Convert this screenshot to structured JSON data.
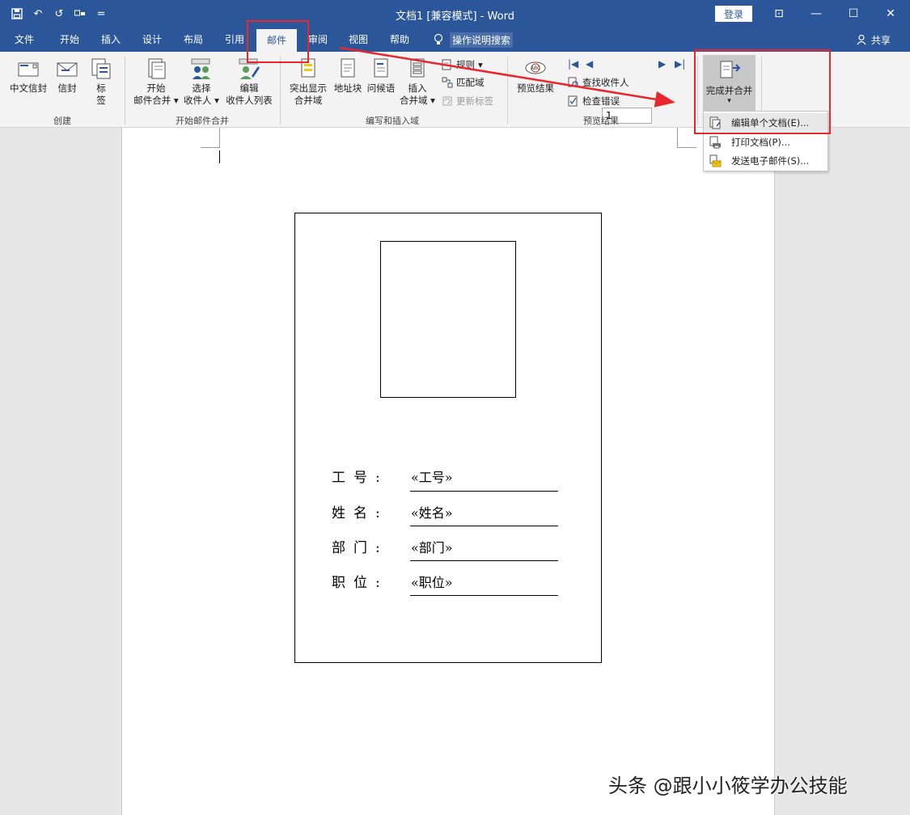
{
  "window": {
    "title": "文档1 [兼容模式] - Word",
    "login": "登录",
    "minimize": "—",
    "maximize": "☐",
    "close": "✕",
    "ribbon_display": "⊡"
  },
  "qat": {
    "save": "save-icon",
    "undo": "↶",
    "redo": "↺",
    "customize": "="
  },
  "tabs": [
    {
      "id": "file",
      "label": "文件"
    },
    {
      "id": "home",
      "label": "开始"
    },
    {
      "id": "insert",
      "label": "插入"
    },
    {
      "id": "design",
      "label": "设计"
    },
    {
      "id": "layout",
      "label": "布局"
    },
    {
      "id": "references",
      "label": "引用"
    },
    {
      "id": "mailings",
      "label": "邮件"
    },
    {
      "id": "review",
      "label": "审阅"
    },
    {
      "id": "view",
      "label": "视图"
    },
    {
      "id": "help",
      "label": "帮助"
    }
  ],
  "tell_me": "操作说明搜索",
  "share": "共享",
  "ribbon": {
    "create": {
      "label": "创建",
      "envelopes_cn": "中文信封",
      "envelopes": "信封",
      "labels_1": "标",
      "labels_2": "签"
    },
    "start_merge": {
      "label": "开始邮件合并",
      "start_1": "开始",
      "start_2": "邮件合并",
      "select_1": "选择",
      "select_2": "收件人",
      "edit_1": "编辑",
      "edit_2": "收件人列表"
    },
    "write_insert": {
      "label": "编写和插入域",
      "highlight_1": "突出显示",
      "highlight_2": "合并域",
      "address_block": "地址块",
      "greeting": "问候语",
      "insert_1": "插入",
      "insert_2": "合并域",
      "rules": "规则",
      "match_fields": "匹配域",
      "update_labels": "更新标签"
    },
    "preview": {
      "label": "预览结果",
      "preview_btn": "预览结果",
      "record": "1",
      "find_recipient": "查找收件人",
      "check_errors": "检查错误"
    },
    "finish": {
      "finish_btn": "完成并合并"
    }
  },
  "dropdown": {
    "items": [
      {
        "label": "编辑单个文档(E)..."
      },
      {
        "label": "打印文档(P)..."
      },
      {
        "label": "发送电子邮件(S)..."
      }
    ]
  },
  "card": {
    "fields": [
      {
        "label": "工号:",
        "value": "«工号»"
      },
      {
        "label": "姓名:",
        "value": "«姓名»"
      },
      {
        "label": "部门:",
        "value": "«部门»"
      },
      {
        "label": "职位:",
        "value": "«职位»"
      }
    ]
  },
  "watermark": "头条 @跟小小筱学办公技能",
  "colors": {
    "accent": "#2b579a",
    "highlight": "#e8262c",
    "ribbon_bg": "#f3f3f3"
  }
}
